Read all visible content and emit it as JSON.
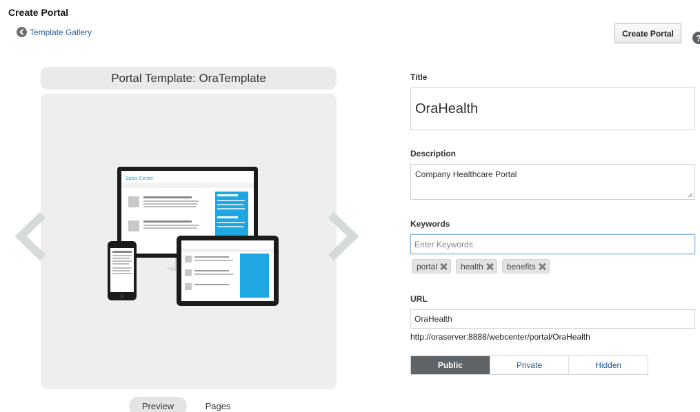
{
  "header": {
    "page_title": "Create Portal",
    "back_link": "Template Gallery",
    "create_button": "Create Portal",
    "help": "?"
  },
  "template": {
    "header_title": "Portal Template: OraTemplate",
    "preview_screen_title": "Sales Center",
    "tabs": [
      "Preview",
      "Pages"
    ],
    "active_tab": "Preview"
  },
  "form": {
    "title_label": "Title",
    "title_value": "OraHealth",
    "description_label": "Description",
    "description_value": "Company Healthcare Portal",
    "keywords_label": "Keywords",
    "keywords_placeholder": "Enter Keywords",
    "keywords": [
      "portal",
      "health",
      "benefits"
    ],
    "url_label": "URL",
    "url_value": "OraHealth",
    "url_full": "http://oraserver:8888/webcenter/portal/OraHealth",
    "visibility_options": [
      "Public",
      "Private",
      "Hidden"
    ],
    "visibility_selected": "Public"
  },
  "colors": {
    "link": "#2a5a96",
    "active_segment": "#5f6468",
    "panel_bg": "#eeeeee",
    "accent_cyan": "#1ea7e1"
  }
}
